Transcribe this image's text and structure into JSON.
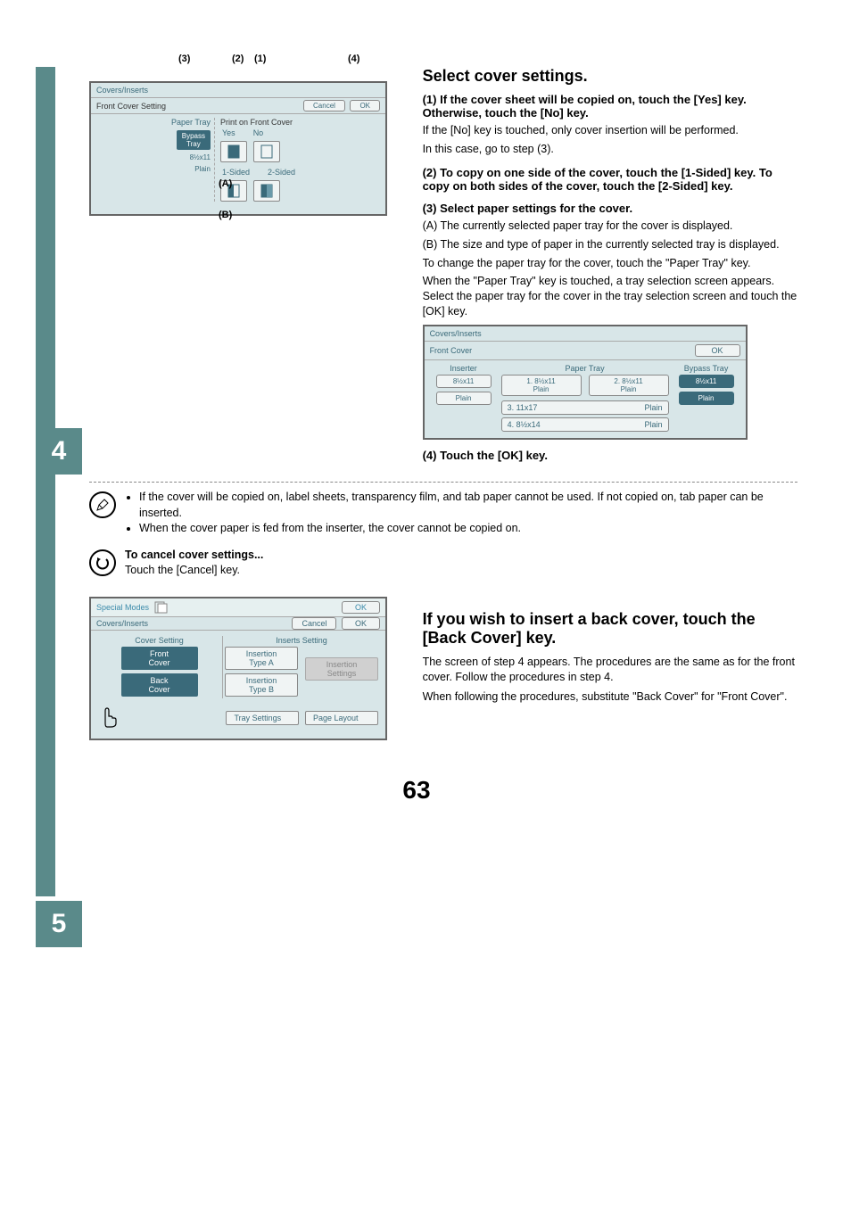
{
  "step4": {
    "callouts": {
      "c3": "(3)",
      "c2": "(2)",
      "c1": "(1)",
      "c4": "(4)",
      "cA": "(A)",
      "cB": "(B)"
    },
    "screen1": {
      "title": "Covers/Inserts",
      "subtitle": "Front Cover Setting",
      "cancel": "Cancel",
      "ok": "OK",
      "paper_tray_label": "Paper Tray",
      "tray_button": "Bypass\nTray",
      "tray_size": "8½x11",
      "tray_type": "Plain",
      "print_on_label": "Print on Front Cover",
      "yes": "Yes",
      "no": "No",
      "one_sided": "1-Sided",
      "two_sided": "2-Sided"
    },
    "heading": "Select cover settings.",
    "item1": {
      "num": "(1)",
      "title": "If the cover sheet will be copied on, touch the [Yes] key. Otherwise, touch the [No] key.",
      "p1": "If the [No] key is touched, only cover insertion will be performed.",
      "p2": "In this case, go to step (3)."
    },
    "item2": {
      "num": "(2)",
      "title": "To copy on one side of the cover, touch the [1-Sided] key. To copy on both sides of the cover, touch the [2-Sided] key."
    },
    "item3": {
      "num": "(3)",
      "title": "Select paper settings for the cover.",
      "A": "(A) The currently selected paper tray for the cover is displayed.",
      "B": "(B) The size and type of paper in the currently selected tray is displayed.",
      "p1": "To change the paper tray for the cover, touch the \"Paper Tray\" key.",
      "p2": "When the \"Paper Tray\" key is touched, a tray selection screen appears. Select the paper tray for the cover in the tray selection screen and touch the [OK] key."
    },
    "screen2": {
      "title": "Covers/Inserts",
      "subtitle": "Front Cover",
      "ok": "OK",
      "inserter": "Inserter",
      "inserter_size": "8½x11",
      "inserter_type": "Plain",
      "paper_tray": "Paper Tray",
      "bypass_tray": "Bypass Tray",
      "bypass_size": "8½x11",
      "bypass_type": "Plain",
      "t1": "1. 8½x11",
      "t1b": "Plain",
      "t2": "2. 8½x11",
      "t2b": "Plain",
      "t3": "3. 11x17",
      "t3b": "Plain",
      "t4": "4. 8½x14",
      "t4b": "Plain"
    },
    "item4": {
      "num": "(4)",
      "title": "Touch the [OK] key."
    }
  },
  "notes": {
    "bullet1": "If the cover will be copied on, label sheets, transparency film, and tab paper cannot be used. If not copied on, tab paper can be inserted.",
    "bullet2": "When the cover paper is fed from the inserter, the cover cannot be copied on.",
    "cancel_title": "To cancel cover settings...",
    "cancel_body": "Touch the [Cancel] key."
  },
  "step5": {
    "screen3": {
      "special_modes": "Special Modes",
      "ok": "OK",
      "title": "Covers/Inserts",
      "cancel": "Cancel",
      "cover_setting": "Cover Setting",
      "inserts_setting": "Inserts Setting",
      "front_cover": "Front\nCover",
      "back_cover": "Back\nCover",
      "ins_a": "Insertion\nType A",
      "ins_b": "Insertion\nType B",
      "ins_settings": "Insertion\nSettings",
      "tray_settings": "Tray Settings",
      "page_layout": "Page Layout"
    },
    "heading": "If you wish to insert a back cover, touch the [Back Cover] key.",
    "p1": "The screen of step 4 appears. The procedures are the same as for the front cover. Follow the procedures in step 4.",
    "p2": "When following the procedures, substitute \"Back Cover\" for \"Front Cover\"."
  },
  "page_number": "63"
}
